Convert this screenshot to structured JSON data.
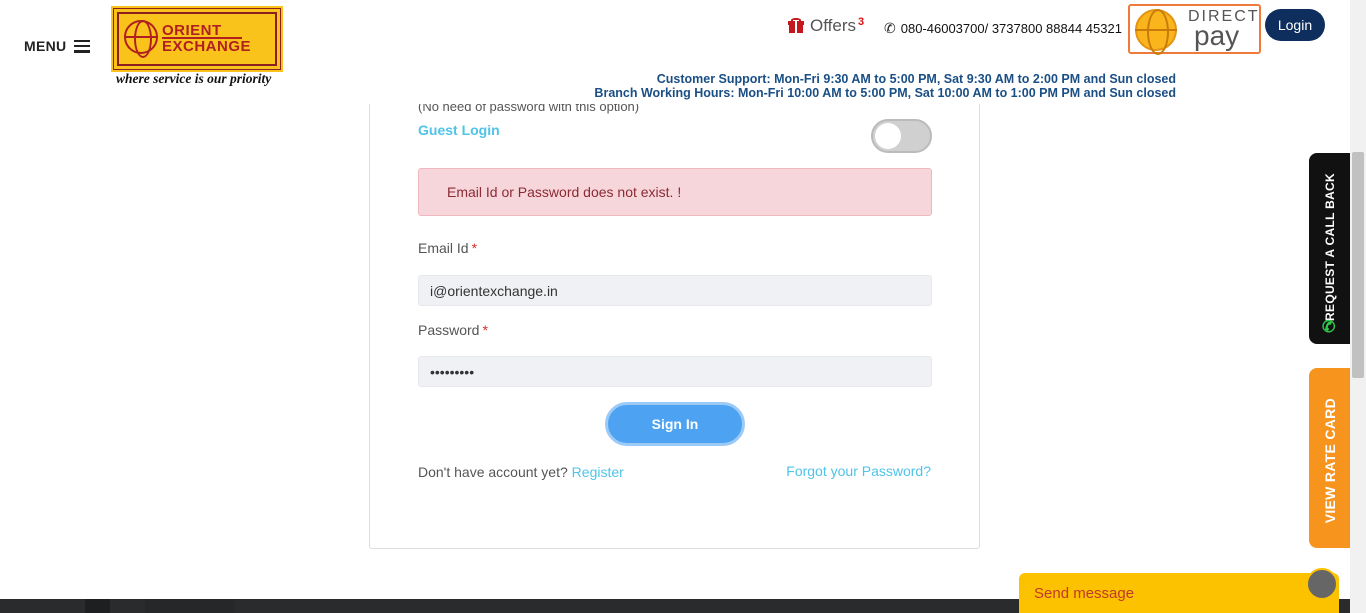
{
  "header": {
    "menu_label": "MENU",
    "logo_line1": "ORIENT",
    "logo_line2": "EXCHANGE",
    "tagline": "where service is our priority",
    "offers_label": "Offers",
    "offers_count": "3",
    "phone": "080-46003700/ 3737800 88844 45321",
    "directpay_direct": "DIRECT",
    "directpay_pay": "pay",
    "login_label": "Login",
    "support_line1": "Customer Support: Mon-Fri 9:30 AM to 5:00 PM, Sat 9:30 AM to 2:00 PM and Sun closed",
    "support_line2": "Branch Working Hours: Mon-Fri 10:00 AM to 5:00 PM, Sat 10:00 AM to 1:00 PM PM and Sun closed"
  },
  "form": {
    "hint": "(No need of password with this option)",
    "guest_login_label": "Guest Login",
    "guest_login_enabled": false,
    "error_message": "Email Id or Password does not exist. !",
    "email_label": "Email Id",
    "email_value": "i@orientexchange.in",
    "password_label": "Password",
    "password_value": "•••••••••",
    "required_mark": "*",
    "signin_label": "Sign In",
    "no_account_text": "Don't have account yet?",
    "register_label": "Register",
    "forgot_label": "Forgot your Password?"
  },
  "side": {
    "callback_label": "REQUEST A CALL BACK",
    "ratecard_label": "VIEW RATE CARD"
  },
  "chat": {
    "send_message_label": "Send message"
  },
  "colors": {
    "brand_yellow": "#f9c31c",
    "brand_red": "#b12020",
    "login_navy": "#0e2e5e",
    "link_cyan": "#4fc3e8",
    "signin_blue": "#4da3f2",
    "rate_orange": "#f7941d",
    "alert_bg": "#f6d6da"
  }
}
